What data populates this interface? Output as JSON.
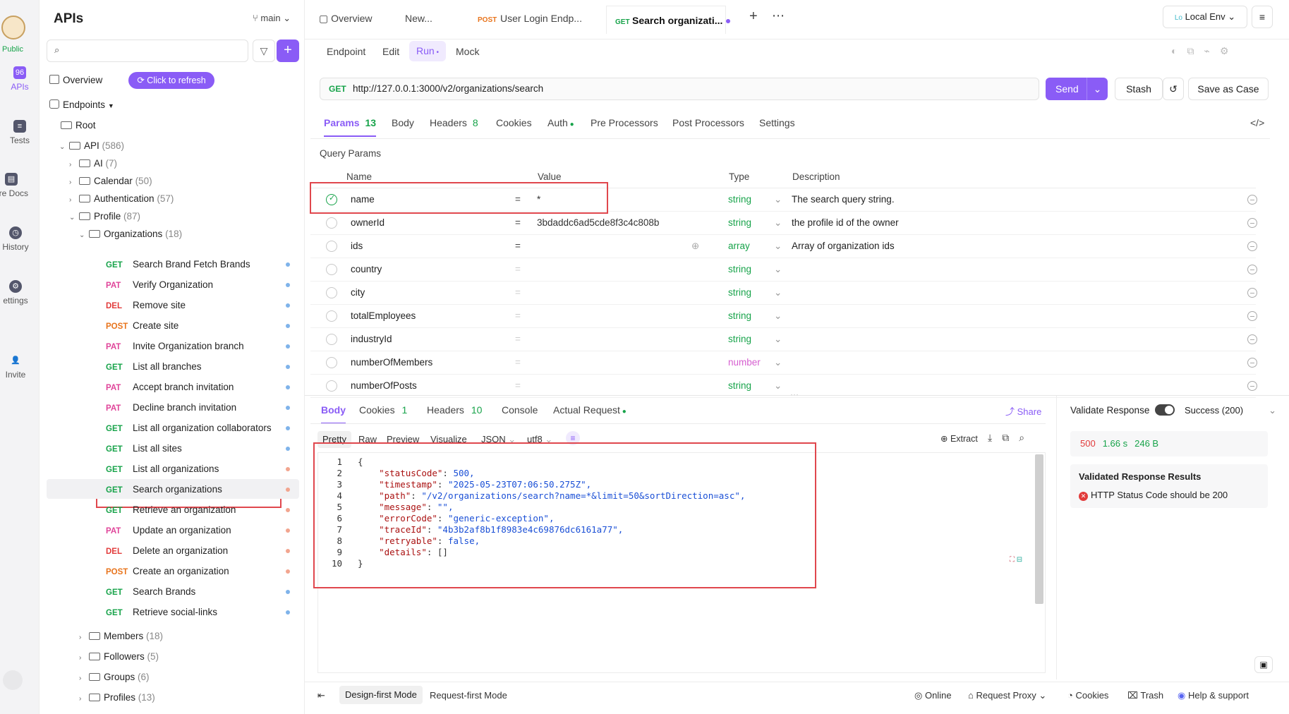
{
  "rail": {
    "badge": "Public",
    "items": [
      {
        "label": "APIs",
        "icon": "apis-icon"
      },
      {
        "label": "Tests",
        "icon": "tests-icon"
      },
      {
        "label": "are Docs",
        "icon": "docs-icon"
      },
      {
        "label": "History",
        "icon": "history-icon"
      },
      {
        "label": "ettings",
        "icon": "settings-icon"
      },
      {
        "label": "Invite",
        "icon": "invite-icon"
      }
    ]
  },
  "sidebar": {
    "title": "APIs",
    "branch": "main",
    "overview": "Overview",
    "refresh": "Click to refresh",
    "endpoints": "Endpoints",
    "root": "Root",
    "api": {
      "label": "API",
      "count": "(586)"
    },
    "folders": [
      {
        "label": "AI",
        "count": "(7)"
      },
      {
        "label": "Calendar",
        "count": "(50)"
      },
      {
        "label": "Authentication",
        "count": "(57)"
      },
      {
        "label": "Profile",
        "count": "(87)"
      },
      {
        "label": "Organizations",
        "count": "(18)"
      }
    ],
    "endpoints_list": [
      {
        "method": "GET",
        "name": "Search Brand Fetch Brands",
        "dot": "#7fb3ea"
      },
      {
        "method": "PAT",
        "name": "Verify Organization",
        "dot": "#7fb3ea"
      },
      {
        "method": "DEL",
        "name": "Remove site",
        "dot": "#7fb3ea"
      },
      {
        "method": "POST",
        "name": "Create site",
        "dot": "#7fb3ea"
      },
      {
        "method": "PAT",
        "name": "Invite Organization branch",
        "dot": "#7fb3ea"
      },
      {
        "method": "GET",
        "name": "List all branches",
        "dot": "#7fb3ea"
      },
      {
        "method": "PAT",
        "name": "Accept branch invitation",
        "dot": "#7fb3ea"
      },
      {
        "method": "PAT",
        "name": "Decline branch invitation",
        "dot": "#7fb3ea"
      },
      {
        "method": "GET",
        "name": "List all organization collaborators",
        "dot": "#7fb3ea"
      },
      {
        "method": "GET",
        "name": "List all sites",
        "dot": "#7fb3ea"
      },
      {
        "method": "GET",
        "name": "List all organizations",
        "dot": "#f2a58f"
      },
      {
        "method": "GET",
        "name": "Search organizations",
        "dot": "#f2a58f"
      },
      {
        "method": "GET",
        "name": "Retrieve an organization",
        "dot": "#f2a58f"
      },
      {
        "method": "PAT",
        "name": "Update an organization",
        "dot": "#f2a58f"
      },
      {
        "method": "DEL",
        "name": "Delete an organization",
        "dot": "#f2a58f"
      },
      {
        "method": "POST",
        "name": "Create an organization",
        "dot": "#f2a58f"
      },
      {
        "method": "GET",
        "name": "Search Brands",
        "dot": "#7fb3ea"
      },
      {
        "method": "GET",
        "name": "Retrieve social-links",
        "dot": "#7fb3ea"
      }
    ],
    "subfolders": [
      {
        "label": "Members",
        "count": "(18)"
      },
      {
        "label": "Followers",
        "count": "(5)"
      },
      {
        "label": "Groups",
        "count": "(6)"
      },
      {
        "label": "Profiles",
        "count": "(13)"
      }
    ]
  },
  "tabs": {
    "overview": "Overview",
    "new": "New...",
    "t3_method": "POST",
    "t3": "User Login Endp...",
    "t4_method": "GET",
    "t4": "Search organizati...",
    "env": "Local Env",
    "env_badge": "Lo"
  },
  "subtabs": [
    "Endpoint",
    "Edit",
    "Run",
    "Mock"
  ],
  "request": {
    "method": "GET",
    "url": "http://127.0.0.1:3000/v2/organizations/search",
    "send": "Send",
    "stash": "Stash",
    "save": "Save as Case"
  },
  "param_tabs": {
    "params": "Params",
    "params_count": "13",
    "body": "Body",
    "headers": "Headers",
    "headers_count": "8",
    "cookies": "Cookies",
    "auth": "Auth",
    "pre": "Pre Processors",
    "post": "Post Processors",
    "settings": "Settings"
  },
  "query": {
    "title": "Query Params",
    "h_name": "Name",
    "h_value": "Value",
    "h_type": "Type",
    "h_desc": "Description",
    "rows": [
      {
        "name": "name",
        "eq": "=",
        "value": "*",
        "type": "string",
        "desc": "The search query string."
      },
      {
        "name": "ownerId",
        "eq": "=",
        "value": "3bdaddc6ad5cde8f3c4c808b",
        "type": "string",
        "desc": "the profile id of the owner"
      },
      {
        "name": "ids",
        "eq": "=",
        "value": "",
        "type": "array",
        "desc": "Array of organization ids"
      },
      {
        "name": "country",
        "eq": "=",
        "value": "",
        "type": "string",
        "desc": ""
      },
      {
        "name": "city",
        "eq": "=",
        "value": "",
        "type": "string",
        "desc": ""
      },
      {
        "name": "totalEmployees",
        "eq": "=",
        "value": "",
        "type": "string",
        "desc": ""
      },
      {
        "name": "industryId",
        "eq": "=",
        "value": "",
        "type": "string",
        "desc": ""
      },
      {
        "name": "numberOfMembers",
        "eq": "=",
        "value": "",
        "type": "number",
        "desc": ""
      },
      {
        "name": "numberOfPosts",
        "eq": "=",
        "value": "",
        "type": "string",
        "desc": ""
      }
    ]
  },
  "response": {
    "tabs": {
      "body": "Body",
      "cookies": "Cookies",
      "cookies_count": "1",
      "headers": "Headers",
      "headers_count": "10",
      "console": "Console",
      "actual": "Actual Request"
    },
    "share": "Share",
    "views": [
      "Pretty",
      "Raw",
      "Preview",
      "Visualize",
      "JSON",
      "utf8"
    ],
    "extract": "Extract",
    "lines": [
      {
        "n": "1",
        "text": "{"
      },
      {
        "n": "2",
        "k": "\"statusCode\"",
        "v": "500,",
        "t": "num"
      },
      {
        "n": "3",
        "k": "\"timestamp\"",
        "v": "\"2025-05-23T07:06:50.275Z\",",
        "t": "str"
      },
      {
        "n": "4",
        "k": "\"path\"",
        "v": "\"/v2/organizations/search?name=*&limit=50&sortDirection=asc\",",
        "t": "str"
      },
      {
        "n": "5",
        "k": "\"message\"",
        "v": "\"\",",
        "t": "str"
      },
      {
        "n": "6",
        "k": "\"errorCode\"",
        "v": "\"generic-exception\",",
        "t": "str"
      },
      {
        "n": "7",
        "k": "\"traceId\"",
        "v": "\"4b3b2af8b1f8983e4c69876dc6161a77\",",
        "t": "str"
      },
      {
        "n": "8",
        "k": "\"retryable\"",
        "v": "false,",
        "t": "num"
      },
      {
        "n": "9",
        "k": "\"details\"",
        "v": "[]",
        "t": "plain"
      },
      {
        "n": "10",
        "text": "}"
      }
    ]
  },
  "validate": {
    "label": "Validate Response",
    "status": "Success (200)",
    "code": "500",
    "time": "1.66 s",
    "size": "246 B",
    "results_title": "Validated Response Results",
    "result": "HTTP Status Code should be 200"
  },
  "footer": {
    "design": "Design-first Mode",
    "request": "Request-first Mode",
    "online": "Online",
    "proxy": "Request Proxy",
    "cookies": "Cookies",
    "trash": "Trash",
    "help": "Help & support"
  }
}
